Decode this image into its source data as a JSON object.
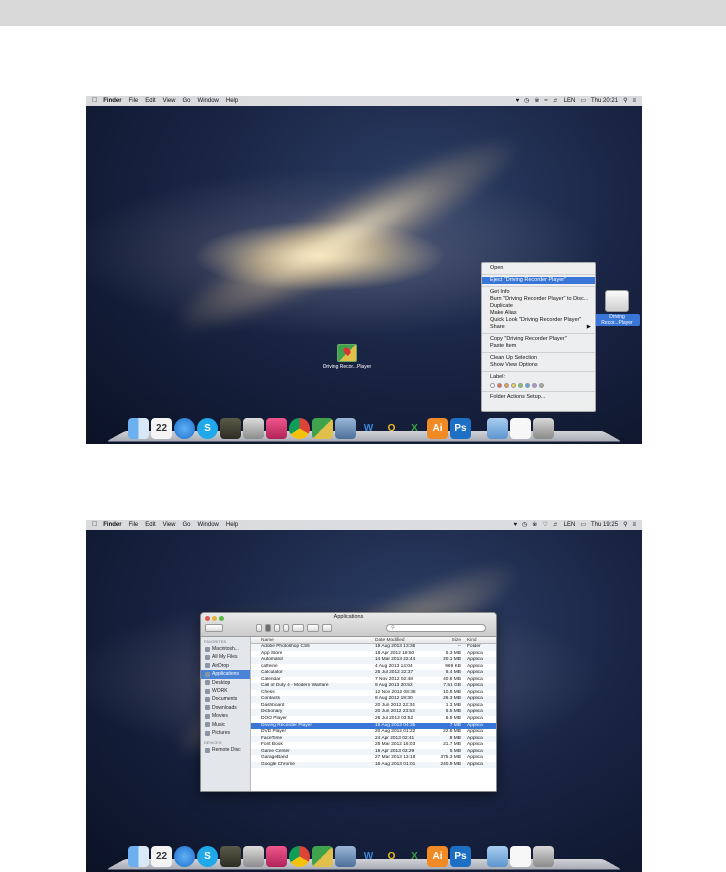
{
  "menubar": {
    "apple": "",
    "items": [
      "Finder",
      "File",
      "Edit",
      "View",
      "Go",
      "Window",
      "Help"
    ],
    "clock_1": "Thu 20:21",
    "clock_2": "Thu 19:25",
    "input": "LEN"
  },
  "screenshot1": {
    "context_menu": {
      "items": [
        "Open",
        "Eject \"Driving Recorder Player\"",
        "Get Info",
        "Burn \"Driving Recorder Player\" to Disc...",
        "Duplicate",
        "Make Alias",
        "Quick Look \"Driving Recorder Player\"",
        "Share",
        "Copy \"Driving Recorder Player\"",
        "Paste Item",
        "Clean Up Selection",
        "Show View Options",
        "Label:",
        "Folder Actions Setup..."
      ],
      "selected_index": 1
    },
    "desktop_icon_app": "Driving Recor...Player",
    "desktop_icon_disk": "Driving Recor...Player"
  },
  "screenshot2": {
    "window_title": "Applications",
    "search_placeholder": "",
    "sidebar": {
      "favorites_header": "FAVORITES",
      "items": [
        "Macintosh...",
        "All My Files",
        "AirDrop",
        "Applications",
        "Desktop",
        "WORK",
        "Documents",
        "Downloads",
        "Movies",
        "Music",
        "Pictures"
      ],
      "selected_index": 3,
      "devices_header": "DEVICES",
      "devices": [
        "Remote Disc"
      ]
    },
    "columns": [
      "Name",
      "Date Modified",
      "Size",
      "Kind"
    ],
    "rows": [
      [
        "Adobe Photoshop CS5",
        "19 Aug 2013 13:36",
        "--",
        "Folder"
      ],
      [
        "App Store",
        "18 Apr 2012 18:50",
        "5.3 MB",
        "Applica"
      ],
      [
        "Automator",
        "14 Mar 2013 22:44",
        "20.1 MB",
        "Applica"
      ],
      [
        "caffeine",
        "4 Aug 2013 14:04",
        "969 KB",
        "Applica"
      ],
      [
        "Calculator",
        "25 Jul 2012 22:37",
        "8.4 MB",
        "Applica"
      ],
      [
        "Calendar",
        "7 Nov 2012 02:48",
        "40.6 MB",
        "Applica"
      ],
      [
        "Call of Duty 4 - Modern Warfare",
        "9 Aug 2013 20:52",
        "7.51 GB",
        "Applica"
      ],
      [
        "Chess",
        "12 Nov 2012 08:38",
        "10.8 MB",
        "Applica"
      ],
      [
        "Contacts",
        "8 Aug 2012 19:30",
        "26.3 MB",
        "Applica"
      ],
      [
        "Dashboard",
        "20 Jun 2012 22:34",
        "1.3 MB",
        "Applica"
      ],
      [
        "Dictionary",
        "20 Jun 2012 23:53",
        "5.5 MB",
        "Applica"
      ],
      [
        "DOO Player",
        "26 Jul 2013 03:52",
        "6.9 MB",
        "Applica"
      ],
      [
        "Driving Recorder Player",
        "19 Aug 2013 04:35",
        "7 MB",
        "Applica"
      ],
      [
        "DVD Player",
        "20 Aug 2012 01:22",
        "22.8 MB",
        "Applica"
      ],
      [
        "FaceTime",
        "24 Apr 2013 02:41",
        "8 MB",
        "Applica"
      ],
      [
        "Font Book",
        "25 Mar 2012 16:03",
        "21.7 MB",
        "Applica"
      ],
      [
        "Game Center",
        "19 Apr 2013 03:29",
        "5 MB",
        "Applica"
      ],
      [
        "GarageBand",
        "27 Mar 2013 13:18",
        "375.3 MB",
        "Applica"
      ],
      [
        "Google Chrome",
        "16 Aug 2013 01:01",
        "240.9 MB",
        "Applica"
      ]
    ],
    "selected_row": 12
  },
  "dock": {
    "icons": [
      "finder-icon",
      "calendar-icon",
      "app-store-icon",
      "skype-icon",
      "call-of-duty-icon",
      "gamepad-icon",
      "tweet-icon",
      "chrome-icon",
      "maps-icon",
      "preview-icon",
      "word-icon",
      "outlook-icon",
      "excel-icon",
      "illustrator-icon",
      "photoshop-icon",
      "folder-icon",
      "document-icon",
      "trash-icon"
    ],
    "calendar_day": "22",
    "labels": {
      "skype": "S",
      "word": "W",
      "outlook": "O",
      "excel": "X",
      "illustrator": "Ai",
      "photoshop": "Ps"
    }
  },
  "colors": {
    "selection": "#3a76d8",
    "menubar": "#ebebeb",
    "label_swatches": [
      "#ffffff",
      "#e8695e",
      "#f0a24a",
      "#f0d84a",
      "#7cc85a",
      "#5aa7e8",
      "#b28ce0",
      "#a8a8a8"
    ]
  }
}
